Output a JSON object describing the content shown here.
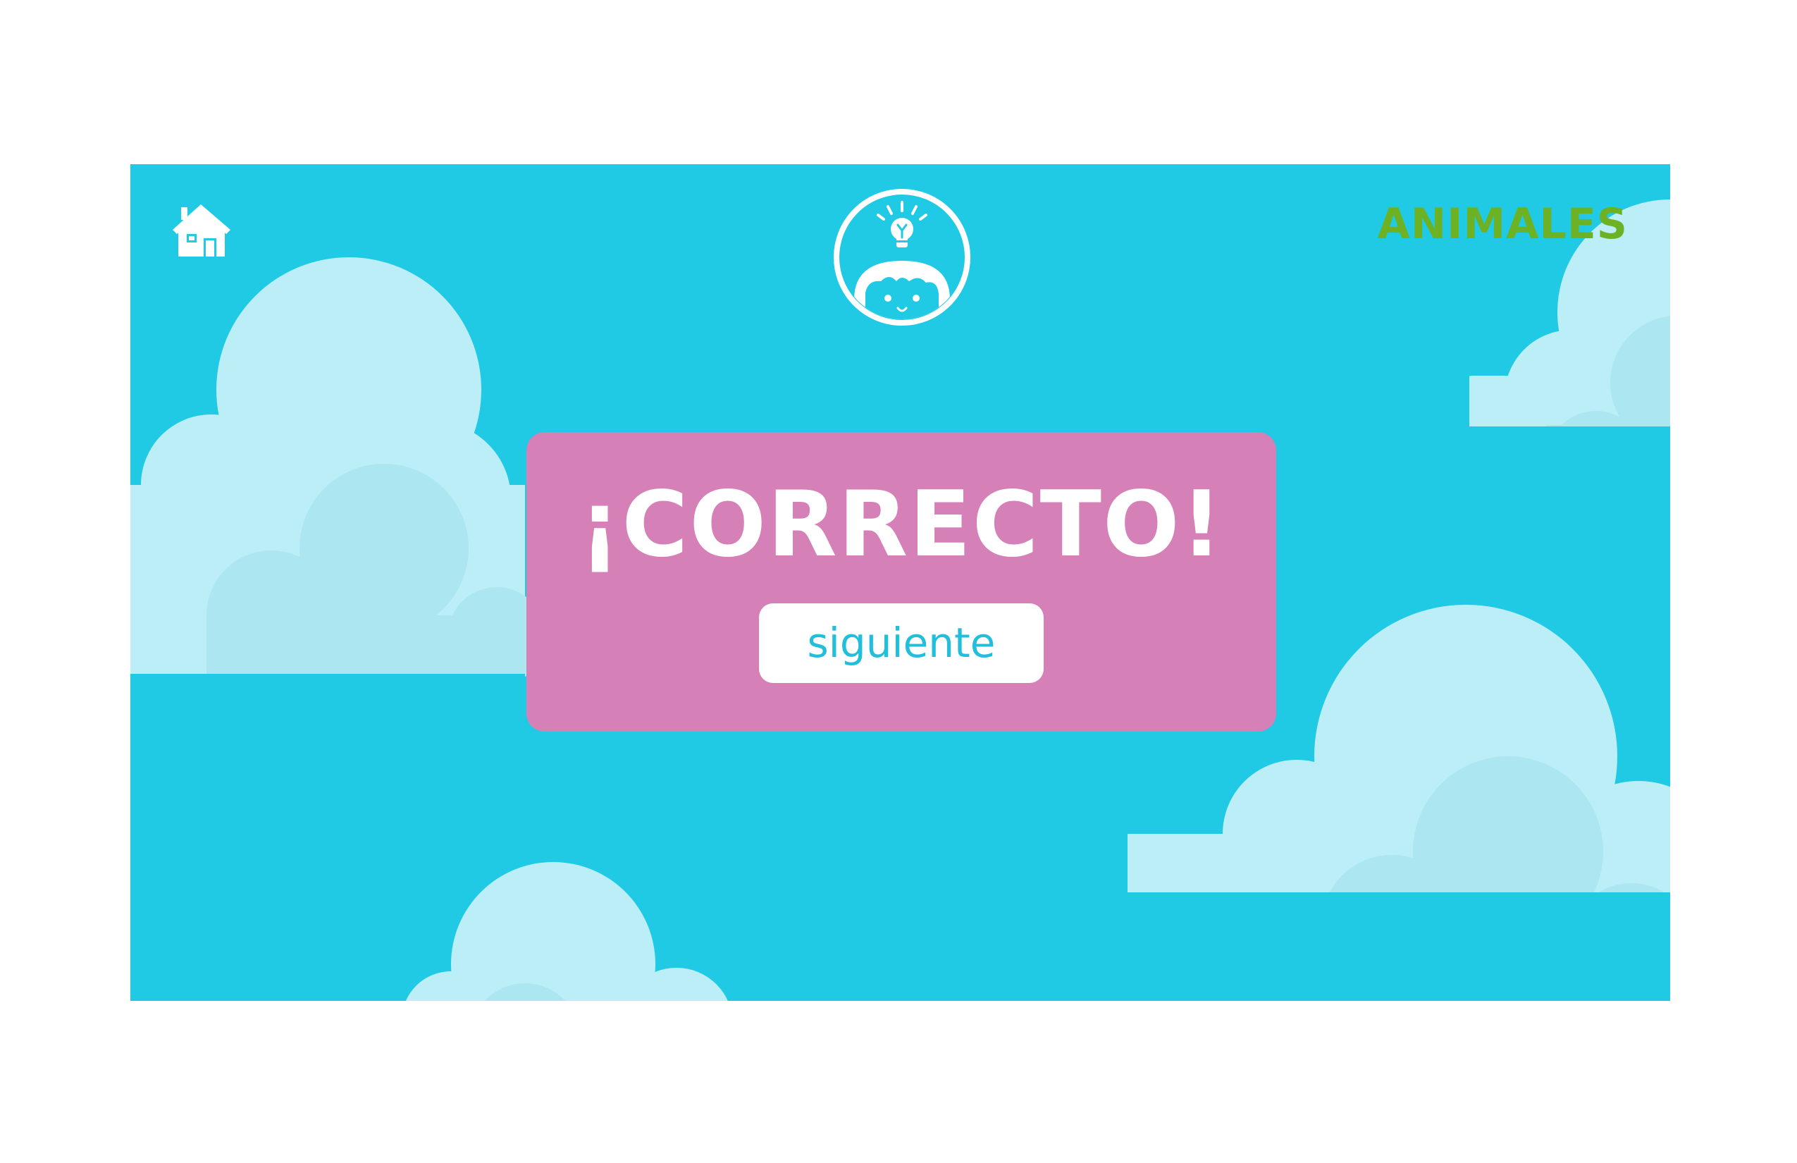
{
  "header": {
    "home_icon": "house-icon",
    "avatar_icon": "child-lightbulb-icon",
    "category_title": "ANIMALES"
  },
  "result": {
    "heading": "¡CORRECTO!",
    "next_label": "siguiente"
  },
  "colors": {
    "sky": "#21cae4",
    "cloud_light": "#bbeef7",
    "cloud_shade": "#abe6f1",
    "panel": "#d680b8",
    "title_green": "#6cb224",
    "button_text": "#21bfdc",
    "white": "#ffffff"
  }
}
